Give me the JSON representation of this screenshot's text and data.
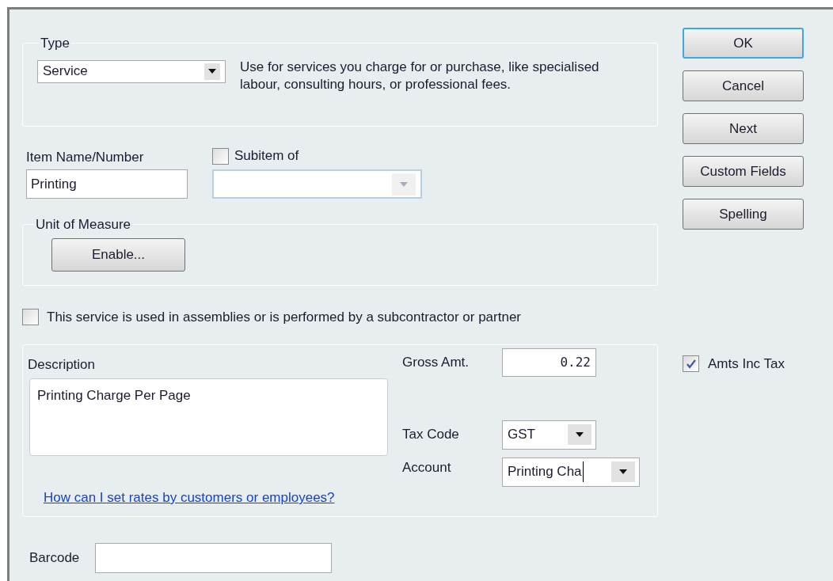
{
  "type_group": {
    "label": "Type",
    "value": "Service",
    "description": "Use for services you charge for or purchase, like specialised labour, consulting hours, or professional fees."
  },
  "item_name": {
    "label": "Item Name/Number",
    "value": "Printing"
  },
  "subitem": {
    "label": "Subitem of",
    "checked": false
  },
  "unit_of_measure": {
    "label": "Unit of Measure",
    "button": "Enable..."
  },
  "assemblies": {
    "label": "This service is used in assemblies or is performed by a subcontractor or partner",
    "checked": false
  },
  "sales": {
    "description_label": "Description",
    "description": "Printing Charge Per Page",
    "gross_label": "Gross Amt.",
    "gross_value": "0.22",
    "tax_code_label": "Tax Code",
    "tax_code": "GST",
    "account_label": "Account",
    "account": "Printing Cha",
    "link": "How can I set rates by customers or employees?"
  },
  "amts_inc_tax": {
    "label": "Amts Inc Tax",
    "checked": true
  },
  "barcode": {
    "label": "Barcode"
  },
  "buttons": [
    {
      "label": "OK",
      "default": true
    },
    {
      "label": "Cancel",
      "default": false
    },
    {
      "label": "Next",
      "default": false
    },
    {
      "label": "Custom Fields",
      "default": false
    },
    {
      "label": "Spelling",
      "default": false
    }
  ]
}
